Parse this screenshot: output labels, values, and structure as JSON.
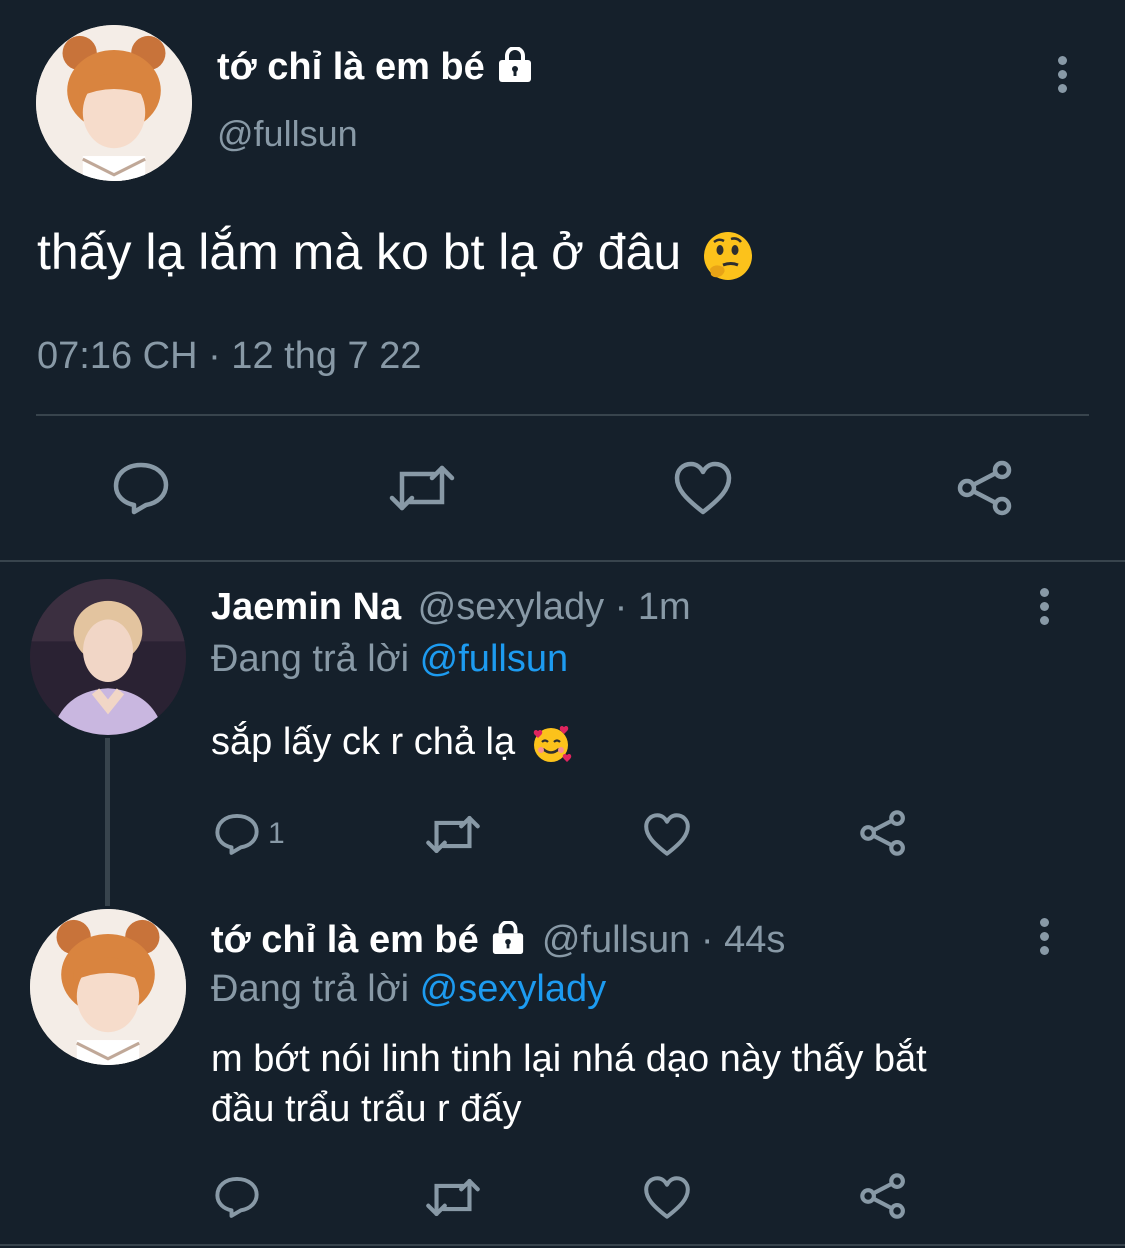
{
  "main_tweet": {
    "display_name": "tớ chỉ là em bé",
    "handle": "@fullsun",
    "text": "thấy lạ lắm mà ko bt lạ ở đâu",
    "emoji": "thinking-face",
    "timestamp": "07:16 CH · 12 thg 7 22"
  },
  "replies": [
    {
      "display_name": "Jaemin Na",
      "handle_time": "@sexylady · 1m",
      "replying_prefix": "Đang trả lời",
      "replying_to": "@fullsun",
      "text": "sắp lấy ck r chả lạ",
      "emoji": "smiling-face-with-hearts",
      "reply_count": "1"
    },
    {
      "display_name": "tớ chỉ là em bé",
      "handle_time": "@fullsun · 44s",
      "replying_prefix": "Đang trả lời",
      "replying_to": "@sexylady",
      "text_line1": "m bớt nói linh tinh lại nhá dạo này thấy bắt",
      "text_line2": "đầu trẩu trẩu r đấy",
      "reply_count": ""
    }
  ],
  "colors": {
    "background": "#15202b",
    "text": "#ffffff",
    "muted": "#8899a6",
    "link": "#1d9bf0",
    "divider": "#38444d"
  }
}
